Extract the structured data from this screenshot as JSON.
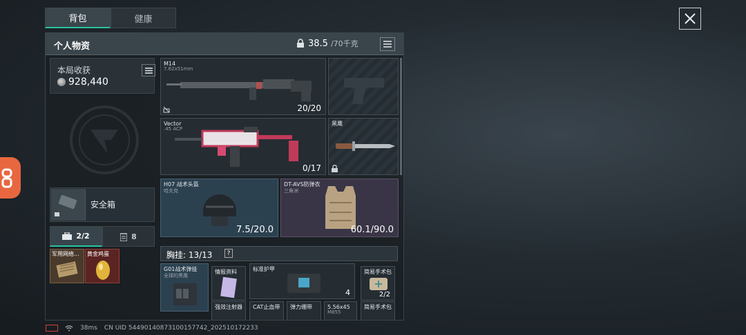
{
  "tabs": [
    "背包",
    "健康"
  ],
  "panel": {
    "title": "个人物资",
    "weight_current": "38.5",
    "weight_max": "/70千克"
  },
  "income": {
    "label": "本局收获",
    "value": "928,440"
  },
  "safe_box": {
    "label": "安全箱"
  },
  "subtabs": [
    "2/2",
    "8"
  ],
  "mini_items": [
    {
      "name": "军用网络..."
    },
    {
      "name": "黄金鸡蛋"
    }
  ],
  "slots": {
    "primary": {
      "name": "M14",
      "sub": "7.62x51mm",
      "count": "20/20"
    },
    "secondary": {
      "name": "Vector",
      "sub": ".45 ACP",
      "count": "0/17"
    },
    "melee": {
      "name": "黑鹰"
    },
    "helmet": {
      "name": "H07 战术头盔",
      "sub": "哈夫克",
      "count": "7.5/20.0"
    },
    "armor": {
      "name": "DT-AVS防弹衣",
      "sub": "三角洲",
      "count": "60.1/90.0"
    }
  },
  "chest_rig": {
    "title": "胸挂:  13/13",
    "help": "?",
    "rig_name": "G01战术弹挂",
    "rig_sub": "全球的黑鹰",
    "items": [
      {
        "name": "情报资料"
      },
      {
        "name": "标准护甲",
        "count": "4"
      },
      {
        "name": "简易手术包",
        "count": "2/2"
      },
      {
        "name": "强效注射器"
      },
      {
        "name": "CAT止血带"
      },
      {
        "name": "弹力绷带"
      },
      {
        "name": "5.56x45",
        "sub": "M855"
      },
      {
        "name": "简易手术包"
      }
    ]
  },
  "status": {
    "ping": "38ms",
    "uid": "CN UID 54490140873100157742_202510172233"
  },
  "colors": {
    "accent": "#28c4a0",
    "gold": "#7e5f3e",
    "red": "#934039"
  }
}
